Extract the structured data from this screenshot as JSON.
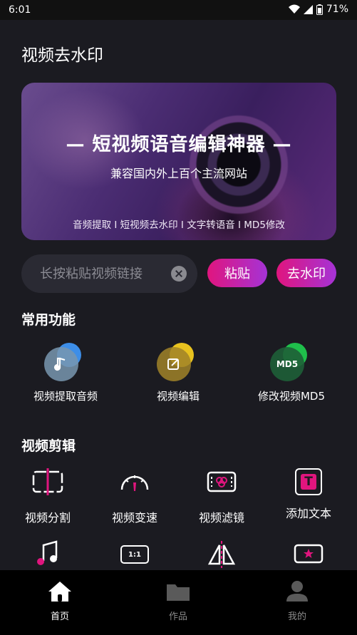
{
  "status": {
    "time": "6:01",
    "battery": "71%"
  },
  "header": {
    "title": "视频去水印"
  },
  "banner": {
    "title": "— 短视频语音编辑神器 —",
    "subtitle": "兼容国内外上百个主流网站",
    "features": "音频提取 I 短视频去水印 I 文字转语音 I MD5修改"
  },
  "search": {
    "placeholder": "长按粘贴视频链接",
    "value": ""
  },
  "buttons": {
    "paste": "粘贴",
    "remove_watermark": "去水印"
  },
  "common": {
    "title": "常用功能",
    "items": [
      {
        "label": "视频提取音频",
        "icon": "music-note-icon"
      },
      {
        "label": "视频编辑",
        "icon": "edit-icon"
      },
      {
        "label": "修改视频MD5",
        "icon": "md5-icon",
        "badge": "MD5"
      }
    ]
  },
  "editing": {
    "title": "视频剪辑",
    "items": [
      {
        "label": "视频分割",
        "icon": "split-icon"
      },
      {
        "label": "视频变速",
        "icon": "speedometer-icon"
      },
      {
        "label": "视频滤镜",
        "icon": "filter-icon"
      },
      {
        "label": "添加文本",
        "icon": "text-icon",
        "glyph": "T"
      }
    ],
    "more": [
      {
        "icon": "music-icon"
      },
      {
        "icon": "ratio-icon",
        "glyph": "1:1"
      },
      {
        "icon": "mirror-icon"
      },
      {
        "icon": "star-frame-icon"
      }
    ]
  },
  "tabs": [
    {
      "label": "首页",
      "icon": "home-icon",
      "active": true
    },
    {
      "label": "作品",
      "icon": "folder-icon",
      "active": false
    },
    {
      "label": "我的",
      "icon": "user-icon",
      "active": false
    }
  ],
  "colors": {
    "accent_start": "#e0157e",
    "accent_end": "#a533d6",
    "background": "#1b1b21"
  }
}
